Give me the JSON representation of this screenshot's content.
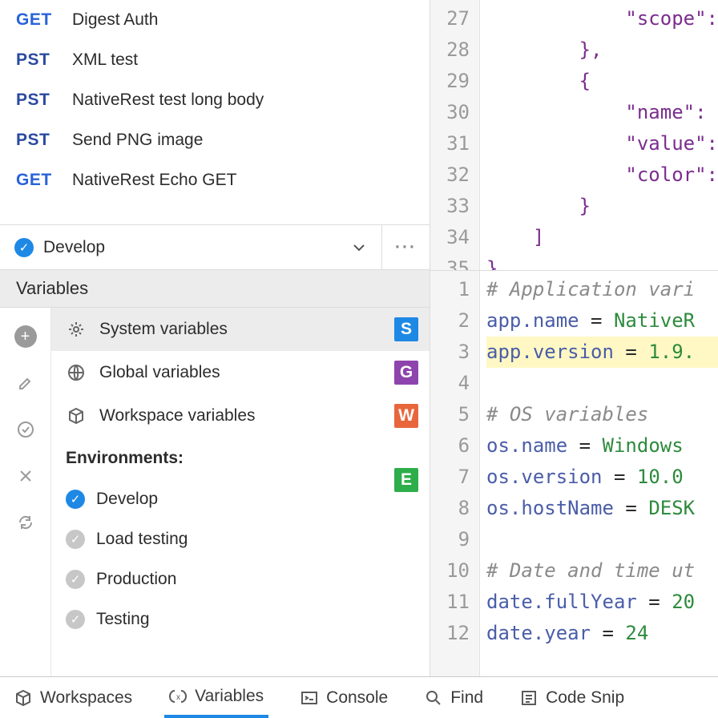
{
  "requests": [
    {
      "method": "GET",
      "cls": "get",
      "name": "Digest Auth"
    },
    {
      "method": "PST",
      "cls": "pst",
      "name": "XML test"
    },
    {
      "method": "PST",
      "cls": "pst",
      "name": "NativeRest test long body"
    },
    {
      "method": "PST",
      "cls": "pst",
      "name": "Send PNG image"
    },
    {
      "method": "GET",
      "cls": "get",
      "name": "NativeRest Echo GET"
    }
  ],
  "env_bar": {
    "selected": "Develop"
  },
  "vars_header": "Variables",
  "var_scopes": [
    {
      "label": "System variables",
      "badge": "S",
      "bclass": "b-s",
      "icon": "gear",
      "sel": true
    },
    {
      "label": "Global variables",
      "badge": "G",
      "bclass": "b-g",
      "icon": "globe"
    },
    {
      "label": "Workspace variables",
      "badge": "W",
      "bclass": "b-w",
      "icon": "box"
    }
  ],
  "environments_header": "Environments:",
  "env_badge": "E",
  "environments": [
    {
      "name": "Develop",
      "active": true
    },
    {
      "name": "Load testing",
      "active": false
    },
    {
      "name": "Production",
      "active": false
    },
    {
      "name": "Testing",
      "active": false
    }
  ],
  "code_top": {
    "start": 27,
    "lines": [
      "            \"scope\":",
      "        },",
      "        {",
      "            \"name\":",
      "            \"value\":",
      "            \"color\":",
      "        }",
      "    ]",
      "}"
    ]
  },
  "code_bot": {
    "lines": [
      {
        "n": 1,
        "html": "<span class='c'># Application vari</span>"
      },
      {
        "n": 2,
        "html": "<span class='k'>app.name</span> = <span class='v'>NativeR</span>"
      },
      {
        "n": 3,
        "html": "<span class='hl'><span class='k'>app.version</span> = <span class='v'>1.9.</span></span>"
      },
      {
        "n": 4,
        "html": ""
      },
      {
        "n": 5,
        "html": "<span class='c'># OS variables</span>"
      },
      {
        "n": 6,
        "html": "<span class='k'>os.name</span> = <span class='v'>Windows </span>"
      },
      {
        "n": 7,
        "html": "<span class='k'>os.version</span> = <span class='v'>10.0</span>"
      },
      {
        "n": 8,
        "html": "<span class='k'>os.hostName</span> = <span class='v'>DESK</span>"
      },
      {
        "n": 9,
        "html": ""
      },
      {
        "n": 10,
        "html": "<span class='c'># Date and time ut</span>"
      },
      {
        "n": 11,
        "html": "<span class='k'>date.fullYear</span> = <span class='v'>20</span>"
      },
      {
        "n": 12,
        "html": "<span class='k'>date.year</span> = <span class='v'>24</span>"
      }
    ]
  },
  "tabs": [
    {
      "label": "Workspaces",
      "icon": "box"
    },
    {
      "label": "Variables",
      "icon": "paren",
      "active": true
    },
    {
      "label": "Console",
      "icon": "term"
    },
    {
      "label": "Find",
      "icon": "search"
    },
    {
      "label": "Code Snip",
      "icon": "snippet"
    }
  ]
}
